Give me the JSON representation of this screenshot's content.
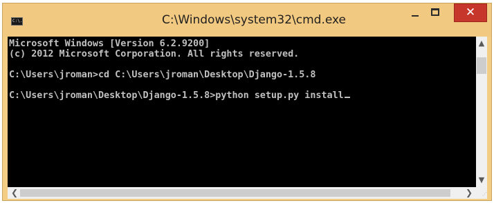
{
  "background_text": "",
  "window": {
    "title": "C:\\Windows\\system32\\cmd.exe",
    "app_icon_label": "C:\\.",
    "controls": {
      "minimize_icon": "minimize-icon",
      "maximize_icon": "maximize-icon",
      "close_label": "✕"
    },
    "colors": {
      "title_bar": "#f2c980",
      "close_button": "#c7362b",
      "console_bg": "#000000",
      "console_text": "#c0c0c0"
    }
  },
  "console": {
    "lines": [
      "Microsoft Windows [Version 6.2.9200]",
      "(c) 2012 Microsoft Corporation. All rights reserved.",
      "",
      "C:\\Users\\jroman>cd C:\\Users\\jroman\\Desktop\\Django-1.5.8",
      "",
      "C:\\Users\\jroman\\Desktop\\Django-1.5.8>python setup.py install"
    ]
  },
  "scrollbars": {
    "up_arrow": "▲",
    "down_arrow": "▼",
    "left_arrow": "❮",
    "right_arrow": "❯",
    "grip": "⋰"
  }
}
